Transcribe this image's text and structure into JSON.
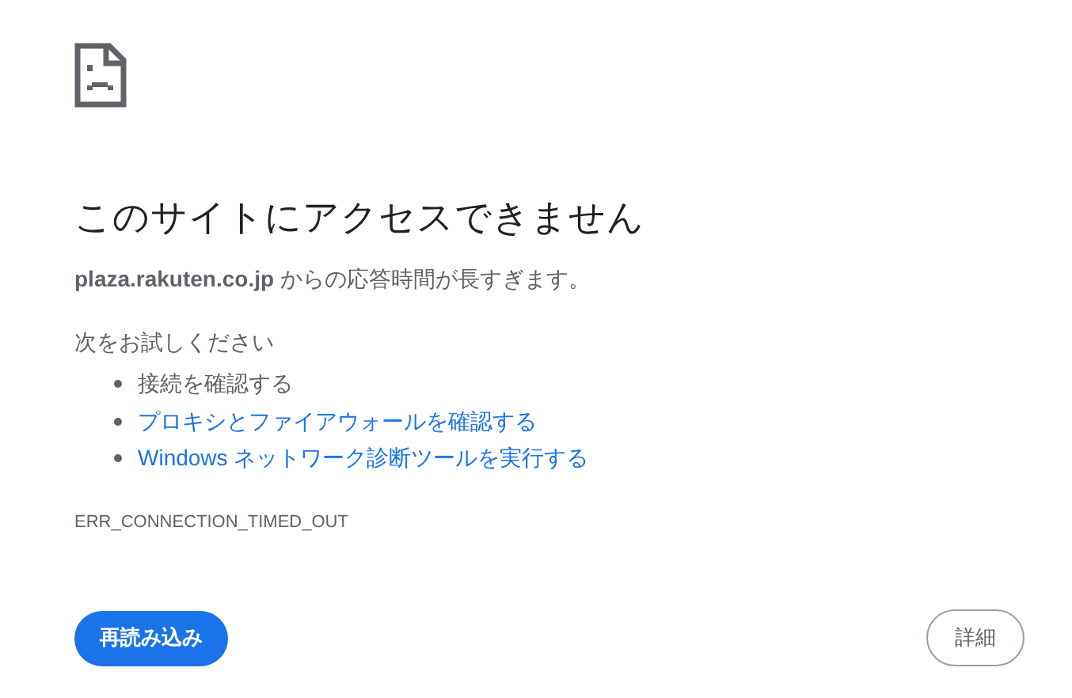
{
  "heading": "このサイトにアクセスできません",
  "message": "**plaza.rakuten.co.jp** からの応答時間が長すぎます。",
  "suggestions_title": "次をお試しください",
  "suggestions": [
    {
      "kind": "text",
      "text": "接続を確認する"
    },
    {
      "kind": "link",
      "text": "プロキシとファイアウォールを確認する"
    },
    {
      "kind": "link",
      "text": "Windows ネットワーク診断ツールを実行する"
    }
  ],
  "error_code": "ERR_CONNECTION_TIMED_OUT",
  "buttons": {
    "reload": "再読み込み",
    "details": "詳細"
  }
}
